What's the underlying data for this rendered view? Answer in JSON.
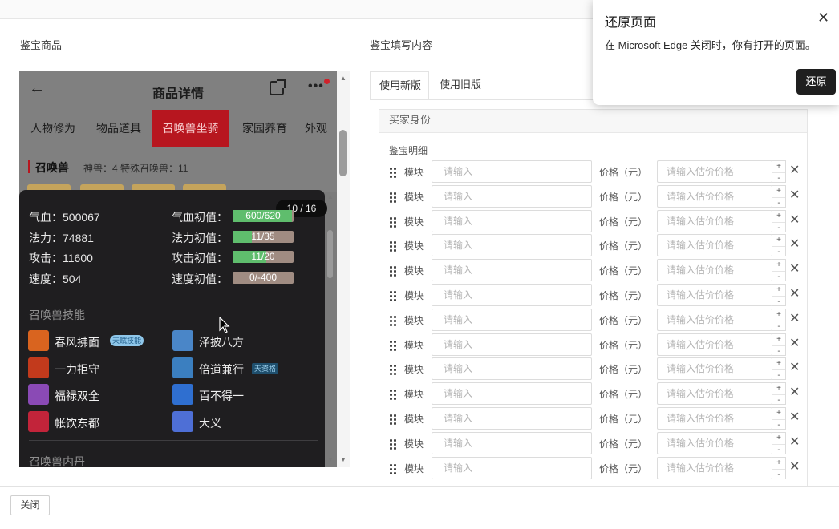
{
  "left": {
    "title": "鉴宝商品"
  },
  "right": {
    "title": "鉴宝填写内容"
  },
  "phone": {
    "nav_title": "商品详情",
    "back_glyph": "←",
    "more_glyph": "•••",
    "categories": [
      "人物修为",
      "物品道具",
      "召唤兽坐骑",
      "家园养育",
      "外观"
    ],
    "active_category": "召唤兽坐骑",
    "beast_title": "召唤兽",
    "beast_count": "神兽：4   特殊召唤兽：11",
    "page_badge": "10 / 16",
    "stats": [
      {
        "label": "气血：500067",
        "init_label": "气血初值：",
        "init_value": "600/620",
        "fill": 0.97
      },
      {
        "label": "法力：74881",
        "init_label": "法力初值：",
        "init_value": "11/35",
        "fill": 0.31
      },
      {
        "label": "攻击：11600",
        "init_label": "攻击初值：",
        "init_value": "11/20",
        "fill": 0.55
      },
      {
        "label": "速度：504",
        "init_label": "速度初值：",
        "init_value": "0/-400",
        "fill": 0.0
      }
    ],
    "skills_title": "召唤兽技能",
    "skills": [
      {
        "name": "春风拂面",
        "tag": "天赋技能",
        "color": "#d9641f"
      },
      {
        "name": "泽披八方",
        "tag": "",
        "color": "#4a86c8"
      },
      {
        "name": "一力拒守",
        "tag": "",
        "color": "#c23a1c"
      },
      {
        "name": "倍道兼行",
        "tag": "天资格",
        "color": "#3b7fc0"
      },
      {
        "name": "福禄双全",
        "tag": "",
        "color": "#8a4ab5"
      },
      {
        "name": "百不得一",
        "tag": "",
        "color": "#2f6fd0"
      },
      {
        "name": "帐饮东都",
        "tag": "",
        "color": "#c2243a"
      },
      {
        "name": "大义",
        "tag": "",
        "color": "#4e6fd6"
      }
    ],
    "inner_title": "召唤兽内丹"
  },
  "tabs": [
    "使用新版",
    "使用旧版"
  ],
  "form": {
    "buyer_label": "买家身份",
    "detail_title": "鉴宝明细",
    "module_label": "模块",
    "module_placeholder": "请输入",
    "price_label": "价格（元）",
    "price_placeholder": "请输入估价价格",
    "plus": "+",
    "minus": "-",
    "remove": "✕",
    "row_count": 13
  },
  "footer": {
    "close_label": "关闭"
  },
  "toast": {
    "title": "还原页面",
    "message": "在 Microsoft Edge 关闭时，你有打开的页面。",
    "restore_label": "还原",
    "close_glyph": "✕"
  }
}
